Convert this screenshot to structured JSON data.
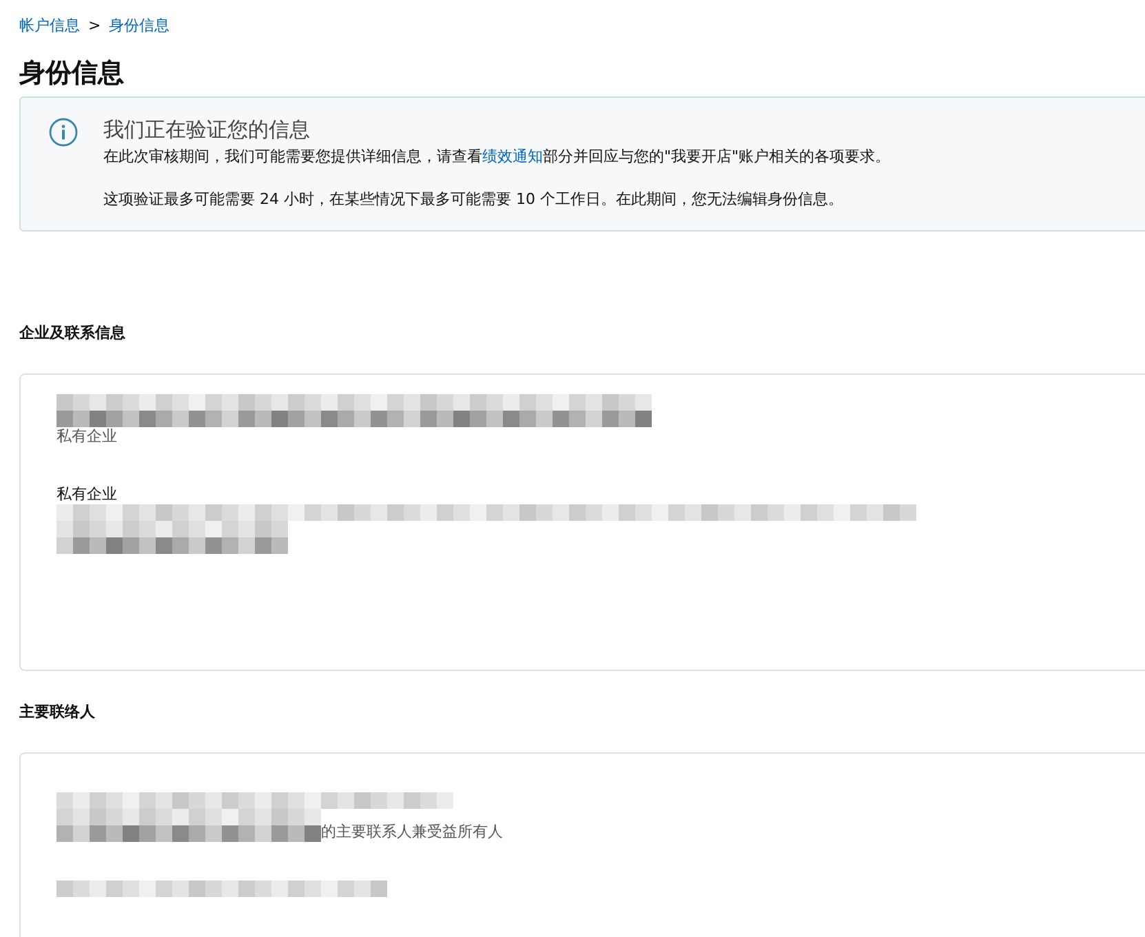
{
  "breadcrumb": [
    {
      "label": "帐户信息"
    },
    {
      "label": "身份信息"
    }
  ],
  "breadcrumb_separator": ">",
  "page_title": "身份信息",
  "alert": {
    "title": "我们正在验证您的信息",
    "paragraphs": [
      [
        {
          "kind": "text",
          "text": "在此次审核期间，我们可能需要您提供详细信息，请查看"
        },
        {
          "kind": "link",
          "text": "绩效通知"
        },
        {
          "kind": "text",
          "text": "部分并回应与您的\"我要开店\"账户相关的各项要求。"
        }
      ],
      [
        {
          "kind": "text",
          "text": "这项验证最多可能需要 24 小时，在某些情况下最多可能需要 10 个工作日。在此期间，您无法编辑身份信息。"
        }
      ]
    ]
  },
  "sections": [
    {
      "heading": "企业及联系信息",
      "lines": [
        {
          "kind": "redacted"
        },
        {
          "kind": "note",
          "text": "私有企业"
        },
        {
          "kind": "gap"
        },
        {
          "kind": "label",
          "text": "私有企业"
        },
        {
          "kind": "redacted"
        },
        {
          "kind": "redacted"
        }
      ]
    },
    {
      "heading": "主要联络人",
      "lines": [
        {
          "kind": "redacted"
        },
        {
          "kind": "redacted_note",
          "text": "的主要联系人兼受益所有人"
        },
        {
          "kind": "gap"
        },
        {
          "kind": "redacted"
        }
      ]
    }
  ]
}
